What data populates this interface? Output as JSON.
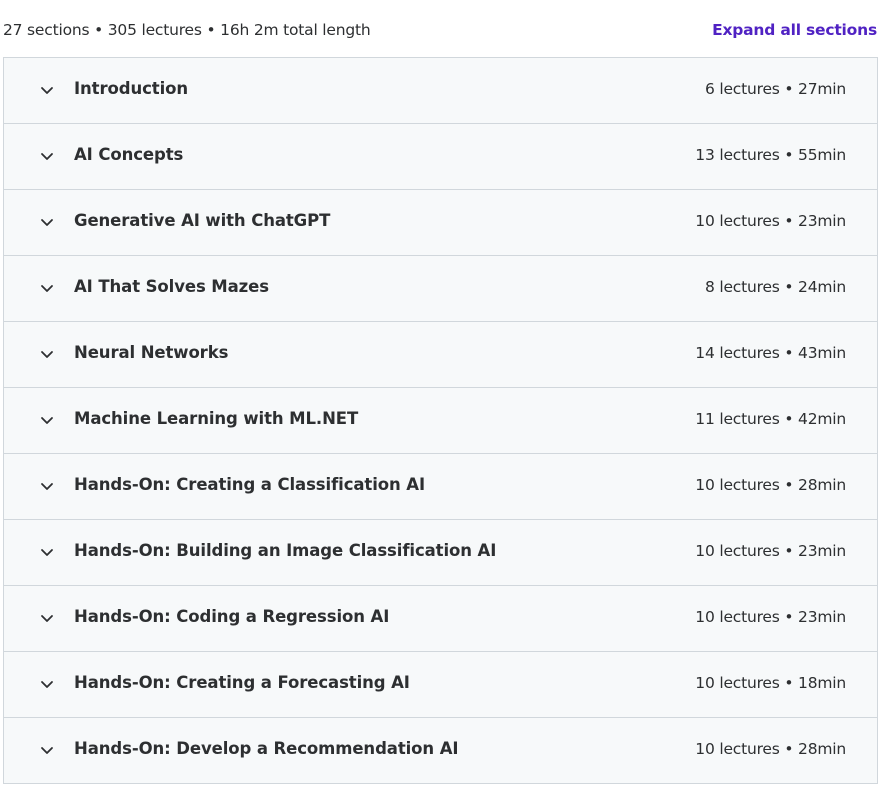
{
  "header": {
    "summary": "27 sections • 305 lectures • 16h 2m total length",
    "expand_all_label": "Expand all sections"
  },
  "icons": {
    "chevron": "chevron-down-icon"
  },
  "colors": {
    "accent": "#5022c3",
    "row_background": "#f7f9fa",
    "border": "#d1d7dc",
    "text": "#2d2f31"
  },
  "sections": [
    {
      "title": "Introduction",
      "meta": "6 lectures • 27min"
    },
    {
      "title": "AI Concepts",
      "meta": "13 lectures • 55min"
    },
    {
      "title": "Generative AI with ChatGPT",
      "meta": "10 lectures • 23min"
    },
    {
      "title": "AI That Solves Mazes",
      "meta": "8 lectures • 24min"
    },
    {
      "title": "Neural Networks",
      "meta": "14 lectures • 43min"
    },
    {
      "title": "Machine Learning with ML.NET",
      "meta": "11 lectures • 42min"
    },
    {
      "title": "Hands-On: Creating a Classification AI",
      "meta": "10 lectures • 28min"
    },
    {
      "title": "Hands-On: Building an Image Classification AI",
      "meta": "10 lectures • 23min"
    },
    {
      "title": "Hands-On: Coding a Regression AI",
      "meta": "10 lectures • 23min"
    },
    {
      "title": "Hands-On: Creating a Forecasting AI",
      "meta": "10 lectures • 18min"
    },
    {
      "title": "Hands-On: Develop a Recommendation AI",
      "meta": "10 lectures • 28min"
    }
  ]
}
